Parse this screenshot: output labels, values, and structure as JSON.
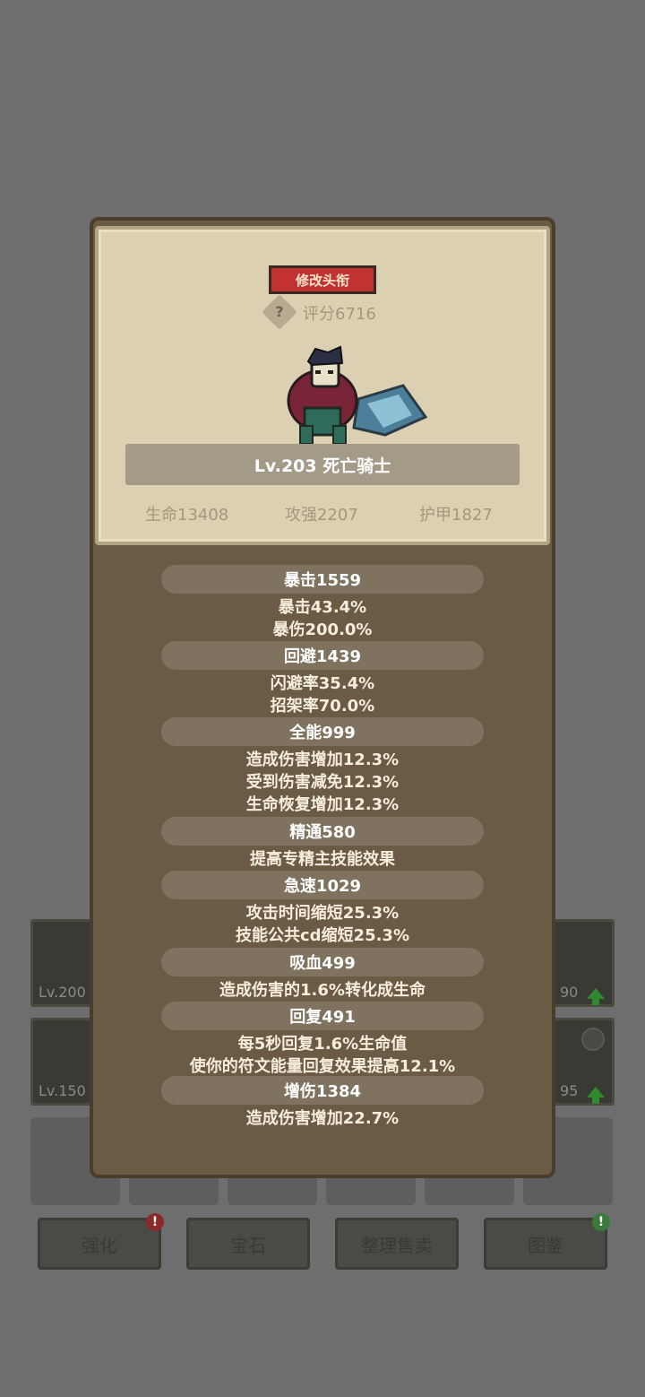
{
  "background": {
    "equip_left": [
      {
        "level": "Lv.200"
      },
      {
        "level": "Lv.150"
      }
    ],
    "equip_right": [
      {
        "level_suffix": "90"
      },
      {
        "level_suffix": "95"
      }
    ],
    "bottom_buttons": [
      {
        "label": "强化"
      },
      {
        "label": "宝石"
      },
      {
        "label": "整理售卖"
      },
      {
        "label": "图鉴"
      }
    ],
    "badge_red": "!",
    "badge_green": "!"
  },
  "panel": {
    "rename_button": "修改头衔",
    "help_icon": "?",
    "score": "评分6716",
    "character": "Lv.203 死亡骑士",
    "base_stats": {
      "hp": "生命13408",
      "attack": "攻强2207",
      "armor": "护甲1827"
    },
    "sections": [
      {
        "header": "暴击1559",
        "lines": [
          "暴击43.4%",
          "暴伤200.0%"
        ]
      },
      {
        "header": "回避1439",
        "lines": [
          "闪避率35.4%",
          "招架率70.0%"
        ]
      },
      {
        "header": "全能999",
        "lines": [
          "造成伤害增加12.3%",
          "受到伤害减免12.3%",
          "生命恢复增加12.3%"
        ]
      },
      {
        "header": "精通580",
        "lines": [
          "提高专精主技能效果"
        ]
      },
      {
        "header": "急速1029",
        "lines": [
          "攻击时间缩短25.3%",
          "技能公共cd缩短25.3%"
        ]
      },
      {
        "header": "吸血499",
        "lines": [
          "造成伤害的1.6%转化成生命"
        ]
      },
      {
        "header": "回复491",
        "lines": [
          "每5秒回复1.6%生命值",
          "使你的符文能量回复效果提高12.1%"
        ]
      },
      {
        "header": "增伤1384",
        "lines": [
          "造成伤害增加22.7%"
        ]
      }
    ]
  },
  "colors": {
    "background": "#6e6e6e",
    "panel": "#6b5a44",
    "panel_top": "#dcd0b2",
    "rename_button": "#c23232",
    "stat_header": "#7f725f"
  }
}
